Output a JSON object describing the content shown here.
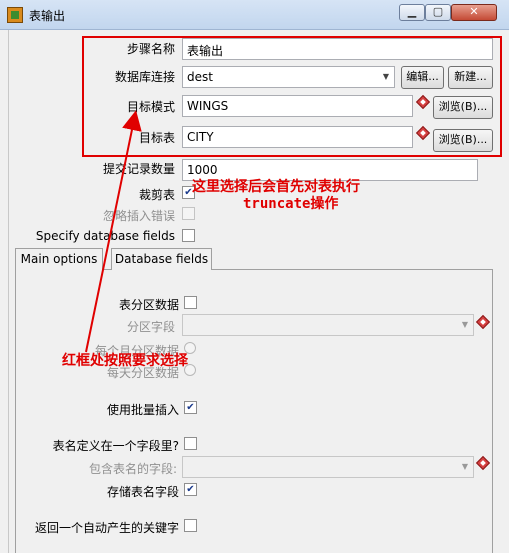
{
  "window": {
    "title": "表输出"
  },
  "form": {
    "step_name_label": "步骤名称",
    "step_name_value": "表输出",
    "db_connection_label": "数据库连接",
    "db_connection_value": "dest",
    "edit_button": "编辑...",
    "new_button": "新建...",
    "target_schema_label": "目标模式",
    "target_schema_value": "WINGS",
    "browse_button": "浏览(B)...",
    "target_table_label": "目标表",
    "target_table_value": "CITY",
    "commit_size_label": "提交记录数量",
    "commit_size_value": "1000",
    "truncate_label": "裁剪表",
    "truncate_checked": "✔",
    "ignore_errors_label": "忽略插入错误",
    "specify_fields_label": "Specify database fields"
  },
  "tabs": {
    "main": "Main options",
    "db_fields": "Database fields"
  },
  "main_options": {
    "partition_label": "表分区数据",
    "partition_field_label": "分区字段",
    "monthly_label": "每个月分区数据",
    "daily_label": "每天分区数据",
    "batch_label": "使用批量插入",
    "batch_checked": "✔",
    "table_in_field_label": "表名定义在一个字段里?",
    "table_field_label": "包含表名的字段:",
    "store_table_field_label": "存储表名字段",
    "store_checked": "✔",
    "return_key_label": "返回一个自动产生的关键字"
  },
  "annotations": {
    "note1_line1": "这里选择后会首先对表执行",
    "note1_line2": "truncate操作",
    "note2": "红框处按照要求选择"
  },
  "colors": {
    "annotation": "#e00000"
  }
}
